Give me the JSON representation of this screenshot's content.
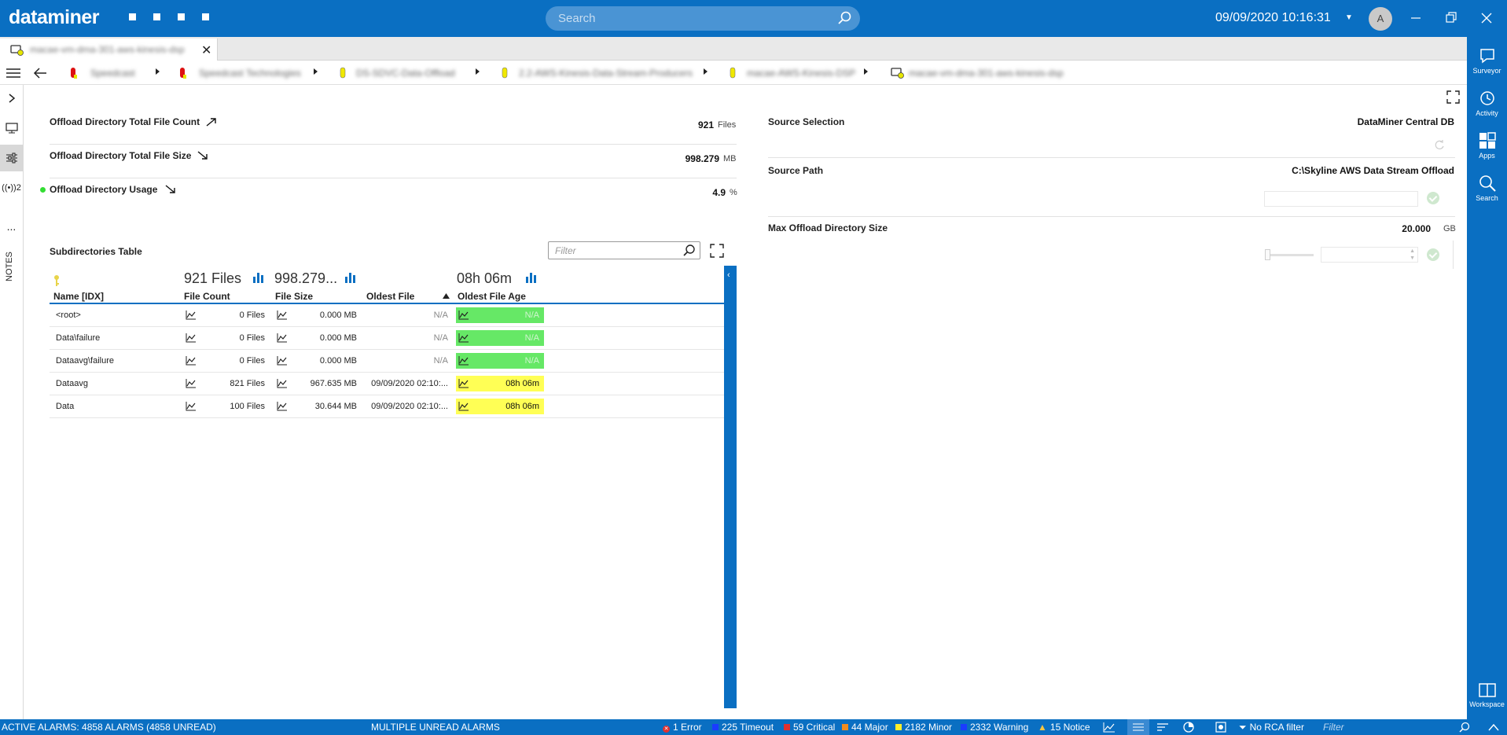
{
  "app": {
    "logo": "dataminer",
    "search_placeholder": "Search",
    "datetime": "09/09/2020 10:16:31",
    "avatar_initial": "A"
  },
  "right_rail": [
    {
      "label": "Surveyor",
      "icon": "surveyor-icon"
    },
    {
      "label": "Activity",
      "icon": "activity-icon"
    },
    {
      "label": "Apps",
      "icon": "apps-icon"
    },
    {
      "label": "Search",
      "icon": "search-icon"
    },
    {
      "label": "Workspace",
      "icon": "workspace-icon"
    }
  ],
  "tab": {
    "label": "macae-vm-dma-301-aws-kinesis-dsp"
  },
  "breadcrumb": [
    {
      "label": "Speedcast",
      "icon": "red"
    },
    {
      "label": "Speedcast Technologies",
      "icon": "red"
    },
    {
      "label": "DS-SDVC-Data-Offload",
      "icon": "yellow"
    },
    {
      "label": "2.2-AWS-Kinesis-Data-Stream-Producers",
      "icon": "yellow"
    },
    {
      "label": "macae-AWS-Kinesis-DSP",
      "icon": "yellow"
    },
    {
      "label": "macae-vm-dma-301-aws-kinesis-dsp",
      "icon": "element"
    }
  ],
  "left_rail": {
    "signal_count": "2",
    "more": "...",
    "notes": "NOTES"
  },
  "params_left": [
    {
      "label": "Offload Directory Total File Count",
      "value": "921",
      "unit": "Files",
      "trend": "up"
    },
    {
      "label": "Offload Directory Total File Size",
      "value": "998.279",
      "unit": "MB",
      "trend": "down"
    },
    {
      "label": "Offload Directory Usage",
      "value": "4.9",
      "unit": "%",
      "trend": "down"
    }
  ],
  "params_right": {
    "source_selection": {
      "label": "Source Selection",
      "value": "DataMiner Central DB"
    },
    "source_path": {
      "label": "Source Path",
      "value": "C:\\Skyline AWS Data Stream Offload"
    },
    "max_size": {
      "label": "Max Offload Directory Size",
      "value": "20.000",
      "unit": "GB"
    }
  },
  "table": {
    "title": "Subdirectories Table",
    "filter_placeholder": "Filter",
    "aggregates": {
      "file_count": "921 Files",
      "file_size": "998.279...",
      "oldest_age": "08h 06m"
    },
    "columns": [
      "Name [IDX]",
      "File Count",
      "File Size",
      "Oldest File",
      "Oldest File Age"
    ],
    "rows": [
      {
        "name": "<root>",
        "count": "0 Files",
        "size": "0.000 MB",
        "oldest": "N/A",
        "age": "N/A",
        "status": "green"
      },
      {
        "name": "Data\\failure",
        "count": "0 Files",
        "size": "0.000 MB",
        "oldest": "N/A",
        "age": "N/A",
        "status": "green"
      },
      {
        "name": "Dataavg\\failure",
        "count": "0 Files",
        "size": "0.000 MB",
        "oldest": "N/A",
        "age": "N/A",
        "status": "green"
      },
      {
        "name": "Dataavg",
        "count": "821 Files",
        "size": "967.635 MB",
        "oldest": "09/09/2020 02:10:...",
        "age": "08h 06m",
        "status": "yellow"
      },
      {
        "name": "Data",
        "count": "100 Files",
        "size": "30.644 MB",
        "oldest": "09/09/2020 02:10:...",
        "age": "08h 06m",
        "status": "yellow"
      }
    ]
  },
  "statusbar": {
    "active_alarms": "ACTIVE ALARMS: 4858 ALARMS (4858 UNREAD)",
    "multiple": "MULTIPLE UNREAD ALARMS",
    "counts": [
      {
        "label": "1 Error",
        "color": "#e23030"
      },
      {
        "label": "225 Timeout",
        "color": "#1a3cff"
      },
      {
        "label": "59 Critical",
        "color": "#e23030"
      },
      {
        "label": "44 Major",
        "color": "#f08c1e"
      },
      {
        "label": "2182 Minor",
        "color": "#ffef2b"
      },
      {
        "label": "2332 Warning",
        "color": "#1a3cff"
      },
      {
        "label": "15 Notice",
        "color": "#f5c542"
      }
    ],
    "rca": "No RCA filter",
    "filter_placeholder": "Filter"
  },
  "colors": {
    "accent": "#0a6fc2",
    "status_green": "#66e866",
    "status_yellow": "#ffff55"
  }
}
